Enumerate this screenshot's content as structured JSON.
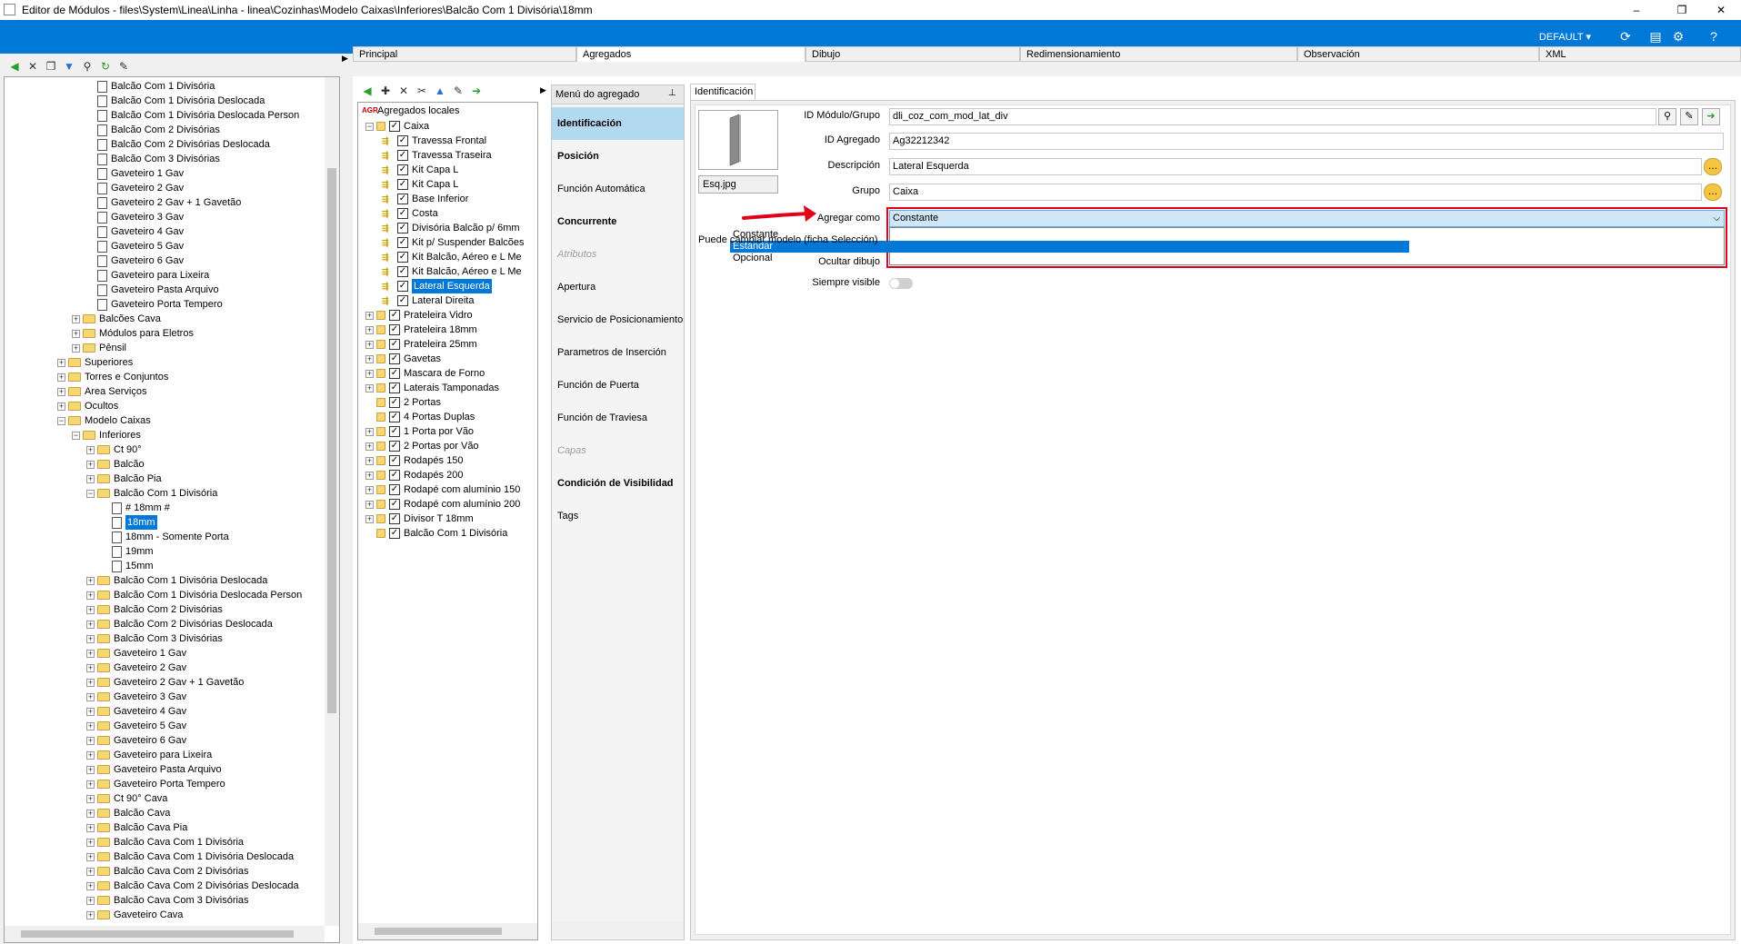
{
  "window": {
    "title": "Editor de Módulos - files\\System\\Linea\\Linha - linea\\Cozinhas\\Modelo Caixas\\Inferiores\\Balcão Com 1 Divisória\\18mm",
    "minimize": "–",
    "maximize": "❐",
    "close": "✕"
  },
  "header": {
    "profile": "DEFAULT ▾"
  },
  "left_tree": {
    "rows": [
      {
        "label": "Balcão Com 1 Divisória",
        "type": "doc",
        "depth": 3
      },
      {
        "label": "Balcão Com 1 Divisória Deslocada",
        "type": "doc",
        "depth": 3
      },
      {
        "label": "Balcão Com 1 Divisória Deslocada Person",
        "type": "doc",
        "depth": 3
      },
      {
        "label": "Balcão Com 2 Divisórias",
        "type": "doc",
        "depth": 3
      },
      {
        "label": "Balcão Com 2 Divisórias Deslocada",
        "type": "doc",
        "depth": 3
      },
      {
        "label": "Balcão Com 3 Divisórias",
        "type": "doc",
        "depth": 3
      },
      {
        "label": "Gaveteiro 1 Gav",
        "type": "doc",
        "depth": 3
      },
      {
        "label": "Gaveteiro 2 Gav",
        "type": "doc",
        "depth": 3
      },
      {
        "label": "Gaveteiro 2 Gav + 1 Gavetão",
        "type": "doc",
        "depth": 3
      },
      {
        "label": "Gaveteiro 3 Gav",
        "type": "doc",
        "depth": 3
      },
      {
        "label": "Gaveteiro 4 Gav",
        "type": "doc",
        "depth": 3
      },
      {
        "label": "Gaveteiro 5 Gav",
        "type": "doc",
        "depth": 3
      },
      {
        "label": "Gaveteiro 6 Gav",
        "type": "doc",
        "depth": 3
      },
      {
        "label": "Gaveteiro para Lixeira",
        "type": "doc",
        "depth": 3
      },
      {
        "label": "Gaveteiro Pasta Arquivo",
        "type": "doc",
        "depth": 3
      },
      {
        "label": "Gaveteiro Porta Tempero",
        "type": "doc",
        "depth": 3
      },
      {
        "label": "Balcões Cava",
        "type": "folder",
        "depth": 2,
        "exp": "+"
      },
      {
        "label": "Módulos para Eletros",
        "type": "folder",
        "depth": 2,
        "exp": "+"
      },
      {
        "label": "Pênsil",
        "type": "folder",
        "depth": 2,
        "exp": "+"
      },
      {
        "label": "Superiores",
        "type": "folder",
        "depth": 1,
        "exp": "+"
      },
      {
        "label": "Torres e Conjuntos",
        "type": "folder",
        "depth": 1,
        "exp": "+"
      },
      {
        "label": "Area Serviços",
        "type": "folder",
        "depth": 1,
        "exp": "+"
      },
      {
        "label": "Ocultos",
        "type": "folder",
        "depth": 1,
        "exp": "+"
      },
      {
        "label": "Modelo Caixas",
        "type": "folder",
        "depth": 1,
        "exp": "−"
      },
      {
        "label": "Inferiores",
        "type": "folder",
        "depth": 2,
        "exp": "−"
      },
      {
        "label": "Ct 90°",
        "type": "folder",
        "depth": 3,
        "exp": "+"
      },
      {
        "label": "Balcão",
        "type": "folder",
        "depth": 3,
        "exp": "+"
      },
      {
        "label": "Balcão Pia",
        "type": "folder",
        "depth": 3,
        "exp": "+"
      },
      {
        "label": "Balcão Com 1 Divisória",
        "type": "folder",
        "depth": 3,
        "exp": "−"
      },
      {
        "label": "# 18mm #",
        "type": "doc",
        "depth": 4
      },
      {
        "label": "18mm",
        "type": "doc",
        "depth": 4,
        "selected": true
      },
      {
        "label": "18mm - Somente Porta",
        "type": "doc",
        "depth": 4
      },
      {
        "label": "19mm",
        "type": "doc",
        "depth": 4
      },
      {
        "label": "15mm",
        "type": "doc",
        "depth": 4
      },
      {
        "label": "Balcão Com 1 Divisória Deslocada",
        "type": "folder",
        "depth": 3,
        "exp": "+"
      },
      {
        "label": "Balcão Com 1 Divisória Deslocada Person",
        "type": "folder",
        "depth": 3,
        "exp": "+"
      },
      {
        "label": "Balcão Com 2 Divisórias",
        "type": "folder",
        "depth": 3,
        "exp": "+"
      },
      {
        "label": "Balcão Com 2 Divisórias Deslocada",
        "type": "folder",
        "depth": 3,
        "exp": "+"
      },
      {
        "label": "Balcão Com 3 Divisórias",
        "type": "folder",
        "depth": 3,
        "exp": "+"
      },
      {
        "label": "Gaveteiro 1 Gav",
        "type": "folder",
        "depth": 3,
        "exp": "+"
      },
      {
        "label": "Gaveteiro 2 Gav",
        "type": "folder",
        "depth": 3,
        "exp": "+"
      },
      {
        "label": "Gaveteiro 2 Gav + 1 Gavetão",
        "type": "folder",
        "depth": 3,
        "exp": "+"
      },
      {
        "label": "Gaveteiro 3 Gav",
        "type": "folder",
        "depth": 3,
        "exp": "+"
      },
      {
        "label": "Gaveteiro 4 Gav",
        "type": "folder",
        "depth": 3,
        "exp": "+"
      },
      {
        "label": "Gaveteiro 5 Gav",
        "type": "folder",
        "depth": 3,
        "exp": "+"
      },
      {
        "label": "Gaveteiro 6 Gav",
        "type": "folder",
        "depth": 3,
        "exp": "+"
      },
      {
        "label": "Gaveteiro para Lixeira",
        "type": "folder",
        "depth": 3,
        "exp": "+"
      },
      {
        "label": "Gaveteiro Pasta Arquivo",
        "type": "folder",
        "depth": 3,
        "exp": "+"
      },
      {
        "label": "Gaveteiro Porta Tempero",
        "type": "folder",
        "depth": 3,
        "exp": "+"
      },
      {
        "label": "Ct 90° Cava",
        "type": "folder",
        "depth": 3,
        "exp": "+"
      },
      {
        "label": "Balcão Cava",
        "type": "folder",
        "depth": 3,
        "exp": "+"
      },
      {
        "label": "Balcão Cava Pia",
        "type": "folder",
        "depth": 3,
        "exp": "+"
      },
      {
        "label": "Balcão Cava Com 1 Divisória",
        "type": "folder",
        "depth": 3,
        "exp": "+"
      },
      {
        "label": "Balcão Cava Com 1 Divisória Deslocada",
        "type": "folder",
        "depth": 3,
        "exp": "+"
      },
      {
        "label": "Balcão Cava Com 2 Divisórias",
        "type": "folder",
        "depth": 3,
        "exp": "+"
      },
      {
        "label": "Balcão Cava Com 2 Divisórias Deslocada",
        "type": "folder",
        "depth": 3,
        "exp": "+"
      },
      {
        "label": "Balcão Cava Com 3 Divisórias",
        "type": "folder",
        "depth": 3,
        "exp": "+"
      },
      {
        "label": "Gaveteiro Cava",
        "type": "folder",
        "depth": 3,
        "exp": "+"
      }
    ]
  },
  "tabs": [
    "Principal",
    "Agregados",
    "Dibujo",
    "Redimensionamiento",
    "Observación",
    "XML"
  ],
  "aggregates_tree": {
    "root_badge": "AGR",
    "root_label": "Agregados locales",
    "rows": [
      {
        "label": "Caixa",
        "depth": 0,
        "exp": "−"
      },
      {
        "label": "Travessa Frontal",
        "depth": 1
      },
      {
        "label": "Travessa Traseira",
        "depth": 1
      },
      {
        "label": "Kit Capa L",
        "depth": 1
      },
      {
        "label": "Kit Capa L",
        "depth": 1
      },
      {
        "label": "Base Inferior",
        "depth": 1
      },
      {
        "label": "Costa",
        "depth": 1
      },
      {
        "label": "Divisória Balcão p/ 6mm",
        "depth": 1
      },
      {
        "label": "Kit p/ Suspender Balcões",
        "depth": 1
      },
      {
        "label": "Kit Balcão, Aéreo e L Me",
        "depth": 1
      },
      {
        "label": "Kit Balcão, Aéreo e L Me",
        "depth": 1
      },
      {
        "label": "Lateral Esquerda",
        "depth": 1,
        "selected": true
      },
      {
        "label": "Lateral Direita",
        "depth": 1
      },
      {
        "label": "Prateleira Vidro",
        "depth": 0,
        "exp": "+"
      },
      {
        "label": "Prateleira 18mm",
        "depth": 0,
        "exp": "+"
      },
      {
        "label": "Prateleira 25mm",
        "depth": 0,
        "exp": "+"
      },
      {
        "label": "Gavetas",
        "depth": 0,
        "exp": "+"
      },
      {
        "label": "Mascara de Forno",
        "depth": 0,
        "exp": "+"
      },
      {
        "label": "Laterais Tamponadas",
        "depth": 0,
        "exp": "+"
      },
      {
        "label": "2 Portas",
        "depth": 0
      },
      {
        "label": "4 Portas Duplas",
        "depth": 0
      },
      {
        "label": "1 Porta por Vão",
        "depth": 0,
        "exp": "+"
      },
      {
        "label": "2 Portas por Vão",
        "depth": 0,
        "exp": "+"
      },
      {
        "label": "Rodapés 150",
        "depth": 0,
        "exp": "+"
      },
      {
        "label": "Rodapés 200",
        "depth": 0,
        "exp": "+"
      },
      {
        "label": "Rodapé com alumínio 150",
        "depth": 0,
        "exp": "+"
      },
      {
        "label": "Rodapé com alumínio 200",
        "depth": 0,
        "exp": "+"
      },
      {
        "label": "Divisor T 18mm",
        "depth": 0,
        "exp": "+"
      },
      {
        "label": "Balcão Com 1 Divisória",
        "depth": 0
      }
    ]
  },
  "menu": {
    "title": "Menú do agregado",
    "items": [
      {
        "label": "Identificación",
        "state": "active"
      },
      {
        "label": "Posición",
        "state": "bold"
      },
      {
        "label": "Función Automática",
        "state": "normal"
      },
      {
        "label": "Concurrente",
        "state": "bold"
      },
      {
        "label": "Atributos",
        "state": "disabled"
      },
      {
        "label": "Apertura",
        "state": "normal"
      },
      {
        "label": "Servicio de Posicionamiento",
        "state": "normal"
      },
      {
        "label": "Parametros de Inserción",
        "state": "normal"
      },
      {
        "label": "Función de Puerta",
        "state": "normal"
      },
      {
        "label": "Función de Traviesa",
        "state": "normal"
      },
      {
        "label": "Capas",
        "state": "disabled"
      },
      {
        "label": "Condición de Visibilidad",
        "state": "bold"
      },
      {
        "label": "Tags",
        "state": "normal"
      }
    ]
  },
  "form": {
    "tab": "Identificación",
    "image_caption": "Esq.jpg",
    "module_id_label": "ID Módulo/Grupo",
    "module_id_value": "dli_coz_com_mod_lat_div",
    "aggregate_id_label": "ID Agregado",
    "aggregate_id_value": "Ag32212342",
    "description_label": "Descripción",
    "description_value": "Lateral Esquerda",
    "group_label": "Grupo",
    "group_value": "Caixa",
    "add_as_label": "Agregar como",
    "add_as_value": "Constante",
    "add_as_options": [
      "Constante",
      "Estándar",
      "Opcional"
    ],
    "add_as_highlighted": 1,
    "can_change_label": "Puede cambiar modelo (ficha Selección)",
    "hide_drawing_label": "Ocultar dibujo",
    "always_visible_label": "Siempre visible"
  },
  "colors": {
    "accent": "#0078d7",
    "highlight_box": "#e0001a",
    "arrow": "#e0001a",
    "menu_active": "#b3d9f0"
  },
  "icons": [
    "back-arrow-icon",
    "delete-icon",
    "copy-icon",
    "move-down-icon",
    "binoculars-icon",
    "refresh-db-icon",
    "tool-icon",
    "new-icon",
    "cut-icon",
    "move-up-icon",
    "export-icon",
    "refresh-icon",
    "layout-icon",
    "settings-icon",
    "help-icon",
    "pin-icon",
    "note-icon",
    "chevron-down-icon"
  ]
}
